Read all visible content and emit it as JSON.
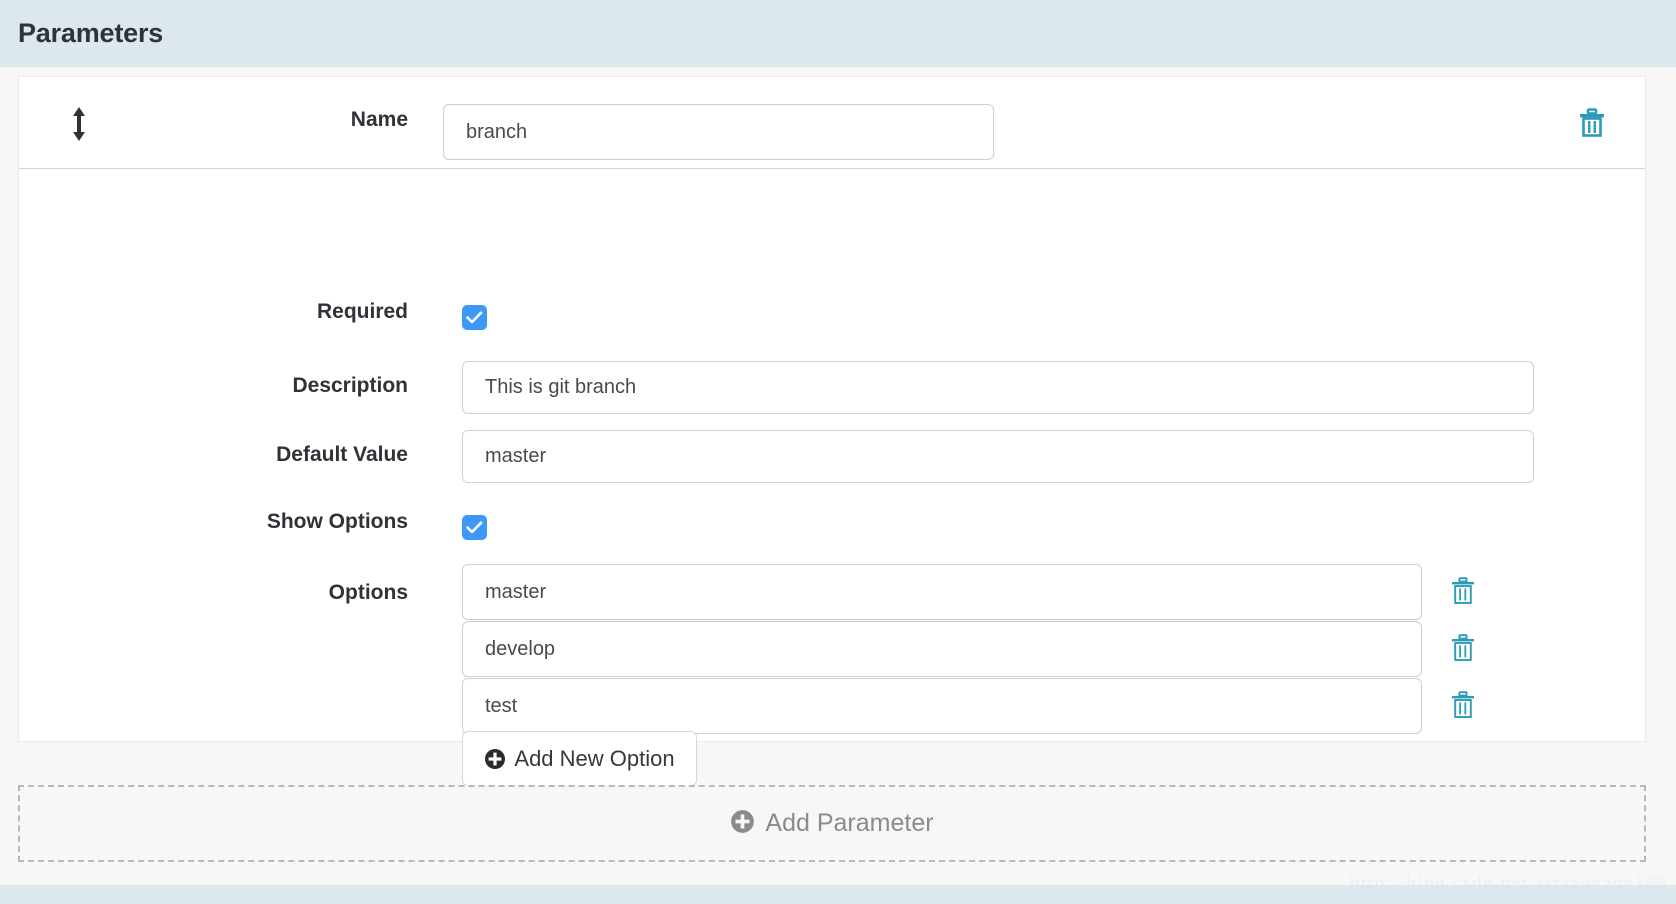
{
  "header": {
    "title": "Parameters"
  },
  "parameter": {
    "drag_handle_icon": "vertical-resize-arrows-icon",
    "delete_icon": "trash-icon",
    "name": {
      "label": "Name",
      "value": "branch",
      "placeholder": "Name"
    },
    "required": {
      "label": "Required",
      "checked": true,
      "check_icon": "checkmark-icon"
    },
    "description": {
      "label": "Description",
      "value": "This is git branch",
      "placeholder": "Description"
    },
    "default_value": {
      "label": "Default Value",
      "value": "master",
      "placeholder": "Default Value"
    },
    "show_options": {
      "label": "Show Options",
      "checked": true,
      "check_icon": "checkmark-icon"
    },
    "options": {
      "label": "Options",
      "items": [
        {
          "value": "master",
          "delete_icon": "trash-icon"
        },
        {
          "value": "develop",
          "delete_icon": "trash-icon"
        },
        {
          "value": "test",
          "delete_icon": "trash-icon"
        }
      ],
      "add_button": {
        "label": "Add New Option",
        "icon": "plus-circle-icon"
      }
    }
  },
  "add_parameter": {
    "label": "Add Parameter",
    "icon": "plus-circle-icon"
  },
  "watermark": {
    "text": "http://blog.csdn.net/aixiaoyang168"
  },
  "colors": {
    "header_background": "#dce8ed",
    "checkbox_accent": "#3d99f5",
    "trash_icon": "#2a9cb8",
    "page_background": "#f7f7f8",
    "muted_text": "#8b8b8b"
  }
}
